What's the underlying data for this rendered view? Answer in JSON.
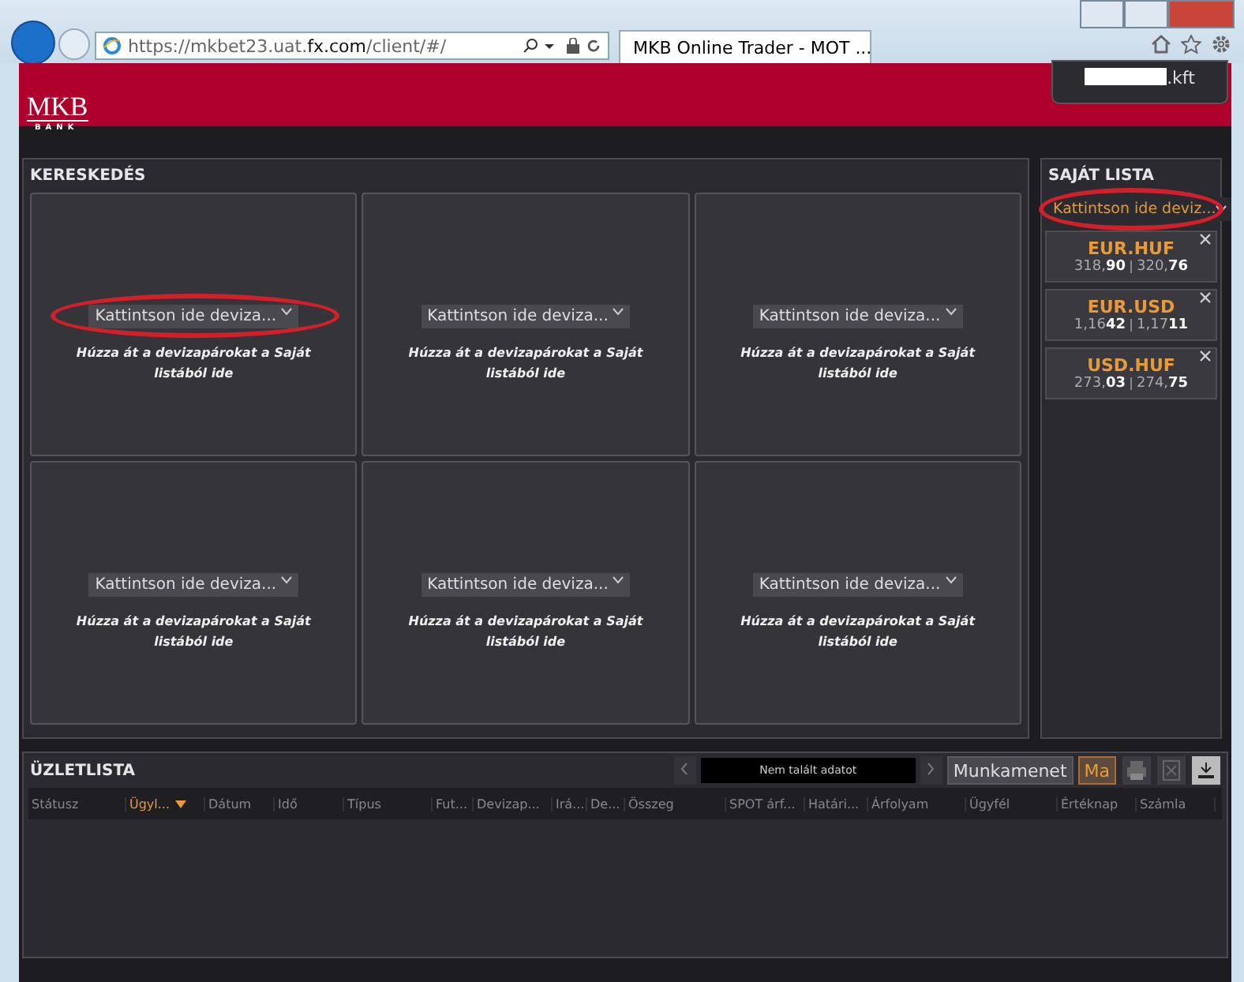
{
  "browser": {
    "url_prefix": "https://",
    "url_host": "mkbet23.uat.",
    "url_domain": "fx.com",
    "url_path": "/client/#/",
    "tab_title": "MKB Online Trader - MOT ..."
  },
  "header": {
    "logo": "MKB",
    "logo_sub": "BANK",
    "user_suffix": ".kft"
  },
  "trading": {
    "title": "KERESKEDÉS",
    "tiles": [
      {
        "select": "Kattintson ide deviza...",
        "hint": "Húzza át a devizapárokat a Saját listából ide",
        "annotated": true
      },
      {
        "select": "Kattintson ide deviza...",
        "hint": "Húzza át a devizapárokat a Saját listából ide",
        "annotated": false
      },
      {
        "select": "Kattintson ide deviza...",
        "hint": "Húzza át a devizapárokat a Saját listából ide",
        "annotated": false
      },
      {
        "select": "Kattintson ide deviza...",
        "hint": "Húzza át a devizapárokat a Saját listából ide",
        "annotated": false
      },
      {
        "select": "Kattintson ide deviza...",
        "hint": "Húzza át a devizapárokat a Saját listából ide",
        "annotated": false
      },
      {
        "select": "Kattintson ide deviza...",
        "hint": "Húzza át a devizapárokat a Saját listából ide",
        "annotated": false
      }
    ]
  },
  "watchlist": {
    "title": "SAJÁT LISTA",
    "select": "Kattintson ide deviz...",
    "annotated": true,
    "items": [
      {
        "pair": "EUR.HUF",
        "bid": "318,**90**",
        "ask": "320,**76**"
      },
      {
        "pair": "EUR.USD",
        "bid": "1,16**42**",
        "ask": "1,17**11**"
      },
      {
        "pair": "USD.HUF",
        "bid": "273,**03**",
        "ask": "274,**75**"
      }
    ]
  },
  "deals": {
    "title": "ÜZLETLISTA",
    "message": "Nem talált adatot",
    "filters": [
      {
        "label": "Munkamenet",
        "selected": false
      },
      {
        "label": "Ma",
        "selected": true
      }
    ],
    "columns": [
      {
        "label": "Státusz",
        "sorted": false
      },
      {
        "label": "Ügyl...",
        "sorted": true
      },
      {
        "label": "Dátum",
        "sorted": false
      },
      {
        "label": "Idő",
        "sorted": false
      },
      {
        "label": "Típus",
        "sorted": false
      },
      {
        "label": "Fut...",
        "sorted": false
      },
      {
        "label": "Devizap...",
        "sorted": false
      },
      {
        "label": "Irá...",
        "sorted": false
      },
      {
        "label": "De...",
        "sorted": false
      },
      {
        "label": "Összeg",
        "sorted": false
      },
      {
        "label": "SPOT árf...",
        "sorted": false
      },
      {
        "label": "Határi...",
        "sorted": false
      },
      {
        "label": "Árfolyam",
        "sorted": false
      },
      {
        "label": "Ügyfél",
        "sorted": false
      },
      {
        "label": "Értéknap",
        "sorted": false
      },
      {
        "label": "Számla",
        "sorted": false
      }
    ]
  }
}
